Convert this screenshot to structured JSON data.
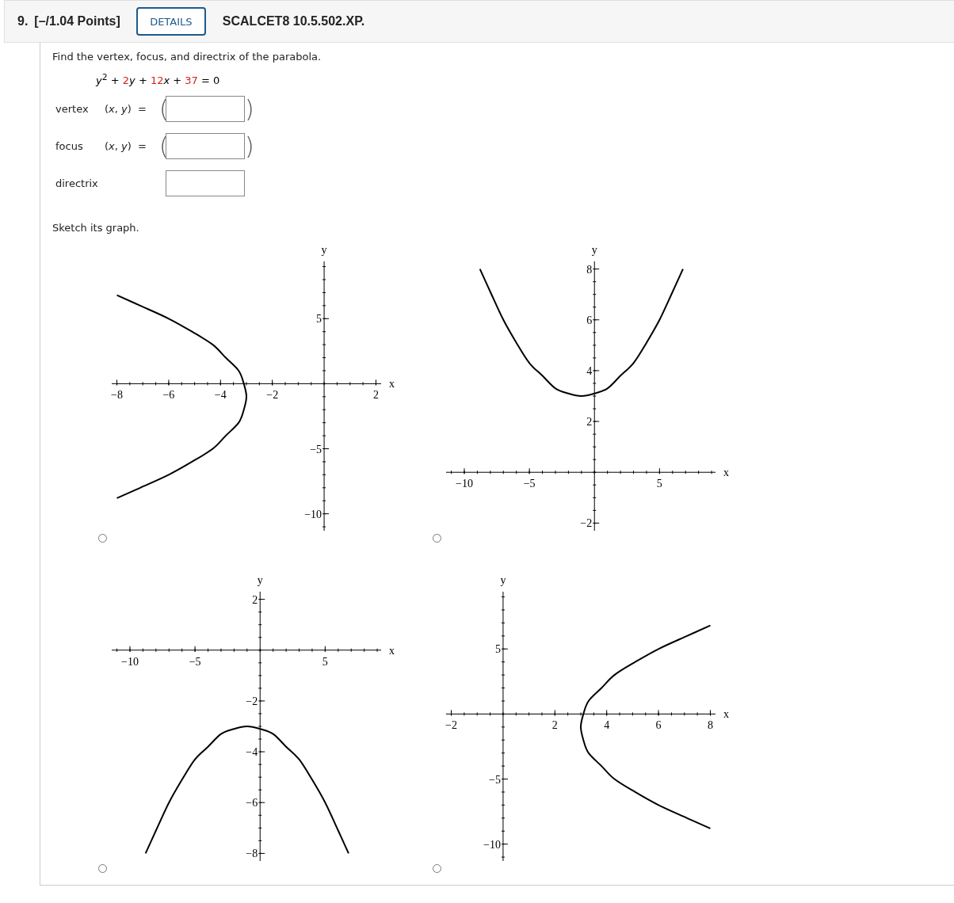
{
  "question": {
    "number": "9.",
    "points": "[–/1.04 Points]",
    "details_button": "DETAILS",
    "code": "SCALCET8 10.5.502.XP."
  },
  "prompt": "Find the vertex, focus, and directrix of the parabola.",
  "equation": [
    {
      "text": "*y*$^{2}$ + ",
      "color": "#000000"
    },
    {
      "text": "2",
      "color": "#d42020"
    },
    {
      "text": "*y* + ",
      "color": "#000000"
    },
    {
      "text": "12",
      "color": "#d42020"
    },
    {
      "text": "*x* + ",
      "color": "#000000"
    },
    {
      "text": "37",
      "color": "#d42020"
    },
    {
      "text": " = 0",
      "color": "#000000"
    }
  ],
  "answers": [
    {
      "kind": "point",
      "label": "vertex",
      "prefix": "(*x*, *y*)  =",
      "open": "(",
      "close": ")"
    },
    {
      "kind": "point",
      "label": "focus",
      "prefix": "(*x*, *y*)  =",
      "open": "(",
      "close": ")"
    },
    {
      "kind": "line",
      "label": "directrix"
    }
  ],
  "sketch_prompt": "Sketch its graph.",
  "options": [
    {
      "selected": false,
      "chart_data": {
        "type": "line",
        "xlabel": "x",
        "ylabel": "y",
        "xlim": [
          -8.2,
          2.2
        ],
        "ylim": [
          -11.3,
          9.4
        ],
        "xticks": [
          {
            "value": -8,
            "label": "−8"
          },
          {
            "value": -6,
            "label": "−6"
          },
          {
            "value": -4,
            "label": "−4"
          },
          {
            "value": -2,
            "label": "−2"
          },
          2
        ],
        "yticks": [
          5,
          {
            "value": -5,
            "label": "−5"
          },
          {
            "value": -10,
            "label": "−10"
          }
        ],
        "x": [
          -8,
          -7.1,
          -6,
          -5.1,
          -4.3,
          -3.8,
          -3.3,
          -3.1,
          -3,
          -3.1,
          -3.3,
          -3.8,
          -4.3,
          -5.1,
          -6,
          -7.1,
          -8
        ],
        "series": [
          {
            "color": "#000000",
            "values": [
              6.8,
              6,
              5,
              4,
              3,
              2,
              1,
              0,
              -1,
              -2,
              -3,
              -4,
              -5,
              -6,
              -7,
              -8,
              -8.8
            ]
          }
        ]
      }
    },
    {
      "selected": false,
      "chart_data": {
        "type": "line",
        "xlabel": "x",
        "ylabel": "y",
        "xlim": [
          -11.4,
          9.3
        ],
        "ylim": [
          -2.3,
          8.3
        ],
        "xticks": [
          {
            "value": -10,
            "label": "−10"
          },
          {
            "value": -5,
            "label": "−5"
          },
          5
        ],
        "yticks": [
          8,
          6,
          4,
          2,
          {
            "value": -2,
            "label": "−2"
          }
        ],
        "x": [
          -8.8,
          -8,
          -7,
          -6,
          -5,
          -4,
          -3,
          -2,
          -1,
          0,
          1,
          2,
          3,
          4,
          5,
          6,
          6.8
        ],
        "series": [
          {
            "color": "#000000",
            "values": [
              8,
              7.1,
              6,
              5.1,
              4.3,
              3.8,
              3.3,
              3.1,
              3,
              3.1,
              3.3,
              3.8,
              4.3,
              5.1,
              6,
              7.1,
              8
            ]
          }
        ]
      }
    },
    {
      "selected": false,
      "chart_data": {
        "type": "line",
        "xlabel": "x",
        "ylabel": "y",
        "xlim": [
          -11.4,
          9.3
        ],
        "ylim": [
          -8.3,
          2.3
        ],
        "xticks": [
          {
            "value": -10,
            "label": "−10"
          },
          {
            "value": -5,
            "label": "−5"
          },
          5
        ],
        "yticks": [
          2,
          {
            "value": -2,
            "label": "−2"
          },
          {
            "value": -4,
            "label": "−4"
          },
          {
            "value": -6,
            "label": "−6"
          },
          {
            "value": -8,
            "label": "−8"
          }
        ],
        "x": [
          -8.8,
          -8,
          -7,
          -6,
          -5,
          -4,
          -3,
          -2,
          -1,
          0,
          1,
          2,
          3,
          4,
          5,
          6,
          6.8
        ],
        "series": [
          {
            "color": "#000000",
            "values": [
              -8,
              -7.1,
              -6,
              -5.1,
              -4.3,
              -3.8,
              -3.3,
              -3.1,
              -3,
              -3.1,
              -3.3,
              -3.8,
              -4.3,
              -5.1,
              -6,
              -7.1,
              -8
            ]
          }
        ]
      }
    },
    {
      "selected": false,
      "chart_data": {
        "type": "line",
        "xlabel": "x",
        "ylabel": "y",
        "xlim": [
          -2.2,
          8.2
        ],
        "ylim": [
          -11.3,
          9.4
        ],
        "xticks": [
          {
            "value": -2,
            "label": "−2"
          },
          2,
          4,
          6,
          8
        ],
        "yticks": [
          5,
          {
            "value": -5,
            "label": "−5"
          },
          {
            "value": -10,
            "label": "−10"
          }
        ],
        "x": [
          8,
          7.1,
          6,
          5.1,
          4.3,
          3.8,
          3.3,
          3.1,
          3,
          3.1,
          3.3,
          3.8,
          4.3,
          5.1,
          6,
          7.1,
          8
        ],
        "series": [
          {
            "color": "#000000",
            "values": [
              6.8,
              6,
              5,
              4,
              3,
              2,
              1,
              0,
              -1,
              -2,
              -3,
              -4,
              -5,
              -6,
              -7,
              -8,
              -8.8
            ]
          }
        ]
      }
    }
  ]
}
